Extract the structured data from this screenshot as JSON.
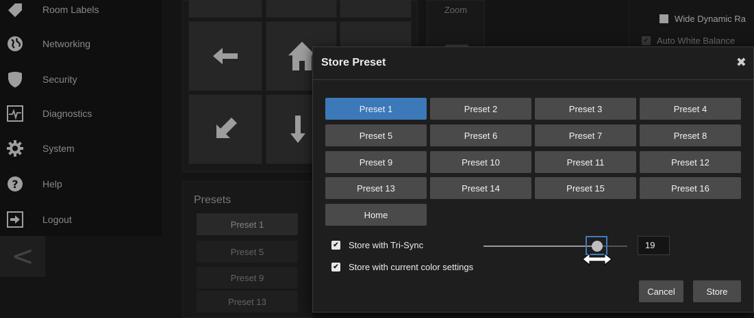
{
  "sidebar": {
    "items": [
      {
        "label": "Room Labels",
        "icon": "tag-icon"
      },
      {
        "label": "Networking",
        "icon": "globe-icon"
      },
      {
        "label": "Security",
        "icon": "shield-icon"
      },
      {
        "label": "Diagnostics",
        "icon": "pulse-icon"
      },
      {
        "label": "System",
        "icon": "gear-icon"
      },
      {
        "label": "Help",
        "icon": "help-icon"
      },
      {
        "label": "Logout",
        "icon": "logout-icon"
      }
    ],
    "collapse_glyph": "<"
  },
  "camera": {
    "zoom_label": "Zoom",
    "options": [
      {
        "label": "Wide Dynamic Ra",
        "checked": false
      },
      {
        "label": "Auto White Balance",
        "checked": true
      }
    ]
  },
  "presets_panel": {
    "title": "Presets",
    "items": [
      "Preset 1",
      "Preset 5",
      "Preset 9",
      "Preset 13"
    ]
  },
  "modal": {
    "title": "Store Preset",
    "close_glyph": "✖",
    "presets": [
      "Preset 1",
      "Preset 2",
      "Preset 3",
      "Preset 4",
      "Preset 5",
      "Preset 6",
      "Preset 7",
      "Preset 8",
      "Preset 9",
      "Preset 10",
      "Preset 11",
      "Preset 12",
      "Preset 13",
      "Preset 14",
      "Preset 15",
      "Preset 16",
      "Home"
    ],
    "selected_preset": "Preset 1",
    "tri_sync_label": "Store with Tri-Sync",
    "tri_sync_checked": true,
    "color_settings_label": "Store with current color settings",
    "color_settings_checked": true,
    "speed_value": "19",
    "cancel_label": "Cancel",
    "store_label": "Store"
  },
  "colors": {
    "accent": "#3b79b8",
    "button": "#4a4a4a",
    "background": "#1c1c1c"
  }
}
